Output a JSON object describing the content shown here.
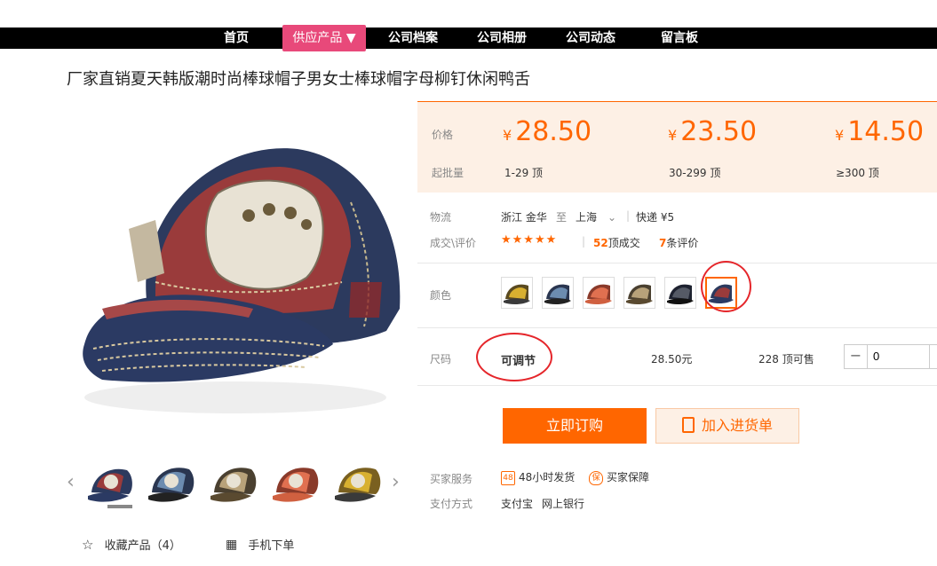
{
  "nav": {
    "items": [
      "首页",
      "供应产品 ▼",
      "公司档案",
      "公司相册",
      "公司动态",
      "留言板"
    ]
  },
  "product": {
    "title": "厂家直销夏天韩版潮时尚棒球帽子男女士棒球帽字母柳钉休闲鸭舌"
  },
  "pricing": {
    "price_label": "价格",
    "moq_label": "起批量",
    "currency": "¥",
    "tiers": [
      {
        "price": "28.50",
        "range": "1-29 顶"
      },
      {
        "price": "23.50",
        "range": "30-299 顶"
      },
      {
        "price": "14.50",
        "range": "≥300 顶"
      }
    ]
  },
  "logistics": {
    "label": "物流",
    "from": "浙江 金华",
    "to_word": "至",
    "to": "上海",
    "express": "快递 ¥5"
  },
  "reviews": {
    "label": "成交\\评价",
    "stars": "★★★★★",
    "deals_count": "52",
    "deals_text": "顶成交",
    "review_count": "7",
    "review_text": "条评价"
  },
  "color": {
    "label": "颜色",
    "swatches": [
      "yellow",
      "blue",
      "red",
      "khaki",
      "black",
      "navy-red"
    ],
    "selected_index": 5
  },
  "size": {
    "label": "尺码",
    "value": "可调节",
    "price": "28.50元",
    "stock": "228 顶可售",
    "minus": "−",
    "quantity": "0"
  },
  "actions": {
    "buy": "立即订购",
    "cart": "加入进货单"
  },
  "service": {
    "label": "买家服务",
    "icon1": "48",
    "item1": "48小时发货",
    "icon2": "保",
    "item2": "买家保障"
  },
  "payment": {
    "label": "支付方式",
    "methods": [
      "支付宝",
      "网上银行"
    ]
  },
  "footer": {
    "fav": "收藏产品（4）",
    "mobile": "手机下单"
  },
  "colors": {
    "accent": "#ff6600",
    "nav_active": "#e8497a",
    "annotation": "#e5262b"
  }
}
